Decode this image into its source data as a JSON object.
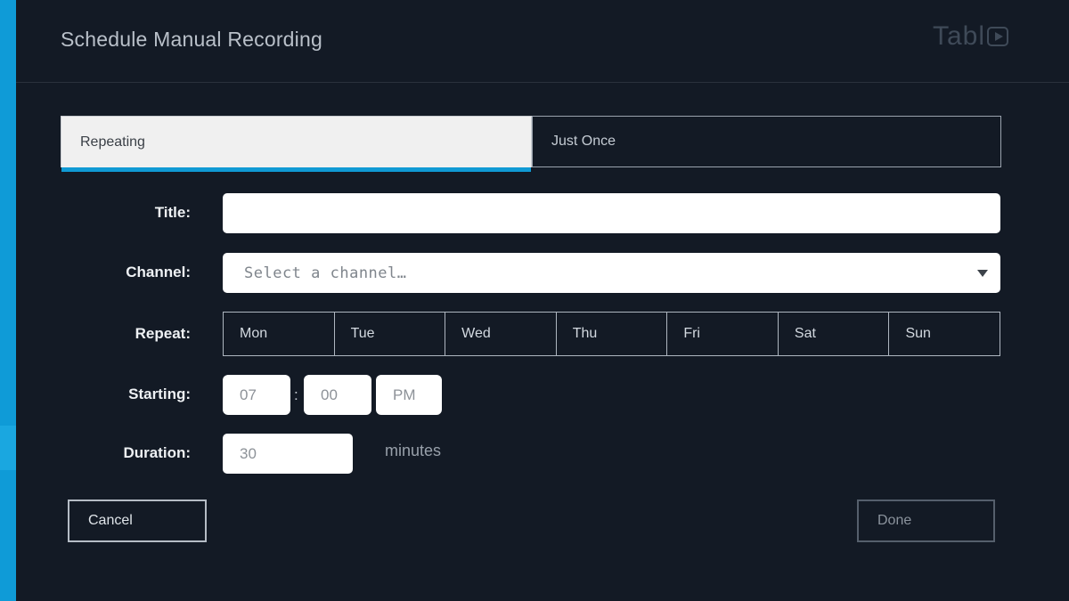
{
  "header": {
    "title": "Schedule Manual Recording",
    "logo_text": "Tabl",
    "logo_icon": "play-in-circle-icon"
  },
  "tabs": [
    {
      "label": "Repeating",
      "active": true
    },
    {
      "label": "Just Once",
      "active": false
    }
  ],
  "form": {
    "title": {
      "label": "Title:",
      "value": "",
      "placeholder": ""
    },
    "channel": {
      "label": "Channel:",
      "value": "",
      "placeholder": "Select a channel…",
      "caret_icon": "chevron-down-icon"
    },
    "repeat": {
      "label": "Repeat:",
      "days": [
        "Mon",
        "Tue",
        "Wed",
        "Thu",
        "Fri",
        "Sat",
        "Sun"
      ]
    },
    "starting": {
      "label": "Starting:",
      "hour": "07",
      "separator": ":",
      "minute": "00",
      "meridiem": "PM"
    },
    "duration": {
      "label": "Duration:",
      "value": "30",
      "units": "minutes"
    }
  },
  "footer": {
    "cancel_label": "Cancel",
    "done_label": "Done"
  },
  "colors": {
    "background": "#131a25",
    "accent_blue": "#0f9bd7",
    "tab_active_underline": "#109ad4",
    "tab_active_background": "#f0f0f0",
    "field_background": "#ffffff",
    "label_text": "#eef1f4",
    "muted_text": "#8d9298"
  }
}
